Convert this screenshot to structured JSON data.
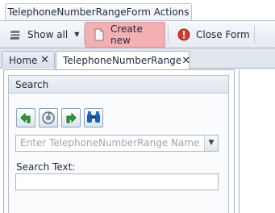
{
  "ribbon": {
    "tab_title": "TelephoneNumberRangeForm Actions"
  },
  "toolbar": {
    "show_all_label": "Show all",
    "create_new_label": "Create new",
    "close_form_label": "Close Form"
  },
  "doc_tabs": [
    {
      "label": "Home"
    },
    {
      "label": "TelephoneNumberRange"
    }
  ],
  "search": {
    "title": "Search",
    "combo_placeholder": "Enter TelephoneNumberRange Name",
    "search_text_label": "Search Text:",
    "search_text_value": ""
  },
  "icons": {
    "create_new": "new-document-icon",
    "close_form": "close-circle-icon",
    "toolbar_buttons": [
      "back-arrow-icon",
      "refresh-icon",
      "forward-arrow-icon",
      "binoculars-icon"
    ]
  },
  "colors": {
    "create_new_highlight": "#f2b0b3",
    "close_icon": "#d23b2b"
  }
}
